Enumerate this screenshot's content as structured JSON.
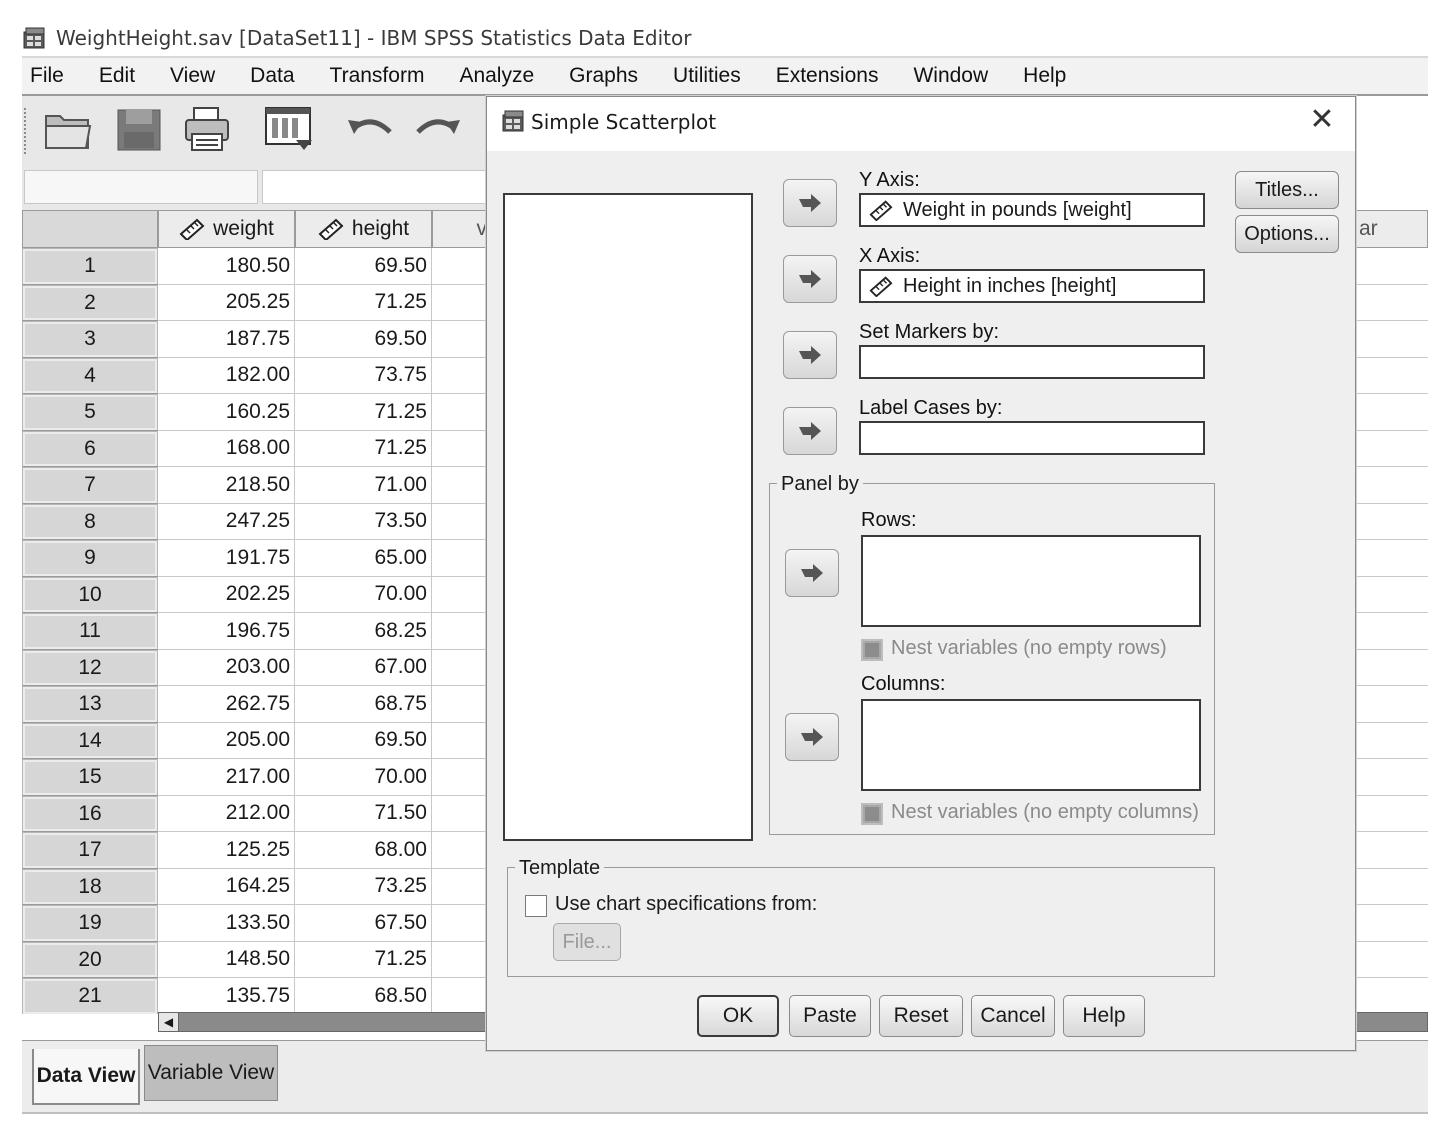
{
  "window": {
    "title": "WeightHeight.sav [DataSet11] - IBM SPSS Statistics Data Editor"
  },
  "menu": [
    "File",
    "Edit",
    "View",
    "Data",
    "Transform",
    "Analyze",
    "Graphs",
    "Utilities",
    "Extensions",
    "Window",
    "Help"
  ],
  "toolbar": {
    "icons": [
      "open-folder-icon",
      "save-icon",
      "print-icon",
      "dialog-recall-icon",
      "undo-icon",
      "redo-icon"
    ]
  },
  "grid": {
    "columns": [
      "weight",
      "height",
      "v"
    ],
    "right_column": "ar",
    "rows": [
      {
        "n": "1",
        "weight": "180.50",
        "height": "69.50"
      },
      {
        "n": "2",
        "weight": "205.25",
        "height": "71.25"
      },
      {
        "n": "3",
        "weight": "187.75",
        "height": "69.50"
      },
      {
        "n": "4",
        "weight": "182.00",
        "height": "73.75"
      },
      {
        "n": "5",
        "weight": "160.25",
        "height": "71.25"
      },
      {
        "n": "6",
        "weight": "168.00",
        "height": "71.25"
      },
      {
        "n": "7",
        "weight": "218.50",
        "height": "71.00"
      },
      {
        "n": "8",
        "weight": "247.25",
        "height": "73.50"
      },
      {
        "n": "9",
        "weight": "191.75",
        "height": "65.00"
      },
      {
        "n": "10",
        "weight": "202.25",
        "height": "70.00"
      },
      {
        "n": "11",
        "weight": "196.75",
        "height": "68.25"
      },
      {
        "n": "12",
        "weight": "203.00",
        "height": "67.00"
      },
      {
        "n": "13",
        "weight": "262.75",
        "height": "68.75"
      },
      {
        "n": "14",
        "weight": "205.00",
        "height": "69.50"
      },
      {
        "n": "15",
        "weight": "217.00",
        "height": "70.00"
      },
      {
        "n": "16",
        "weight": "212.00",
        "height": "71.50"
      },
      {
        "n": "17",
        "weight": "125.25",
        "height": "68.00"
      },
      {
        "n": "18",
        "weight": "164.25",
        "height": "73.25"
      },
      {
        "n": "19",
        "weight": "133.50",
        "height": "67.50"
      },
      {
        "n": "20",
        "weight": "148.50",
        "height": "71.25"
      },
      {
        "n": "21",
        "weight": "135.75",
        "height": "68.50"
      }
    ]
  },
  "tabs": {
    "data_view": "Data View",
    "variable_view": "Variable View"
  },
  "dialog": {
    "title": "Simple Scatterplot",
    "close_glyph": "✕",
    "y_axis_label": "Y Axis:",
    "y_axis_value": "Weight in pounds [weight]",
    "x_axis_label": "X Axis:",
    "x_axis_value": "Height in inches [height]",
    "set_markers_label": "Set Markers by:",
    "label_cases_label": "Label Cases by:",
    "panel_by_title": "Panel by",
    "rows_label": "Rows:",
    "nest_rows_label": "Nest variables (no empty rows)",
    "columns_label": "Columns:",
    "nest_columns_label": "Nest variables (no empty columns)",
    "template_title": "Template",
    "use_chart_spec_label": "Use chart specifications from:",
    "file_button": "File...",
    "titles_button": "Titles...",
    "options_button": "Options...",
    "ok_button": "OK",
    "paste_button": "Paste",
    "reset_button": "Reset",
    "cancel_button": "Cancel",
    "help_button": "Help"
  }
}
